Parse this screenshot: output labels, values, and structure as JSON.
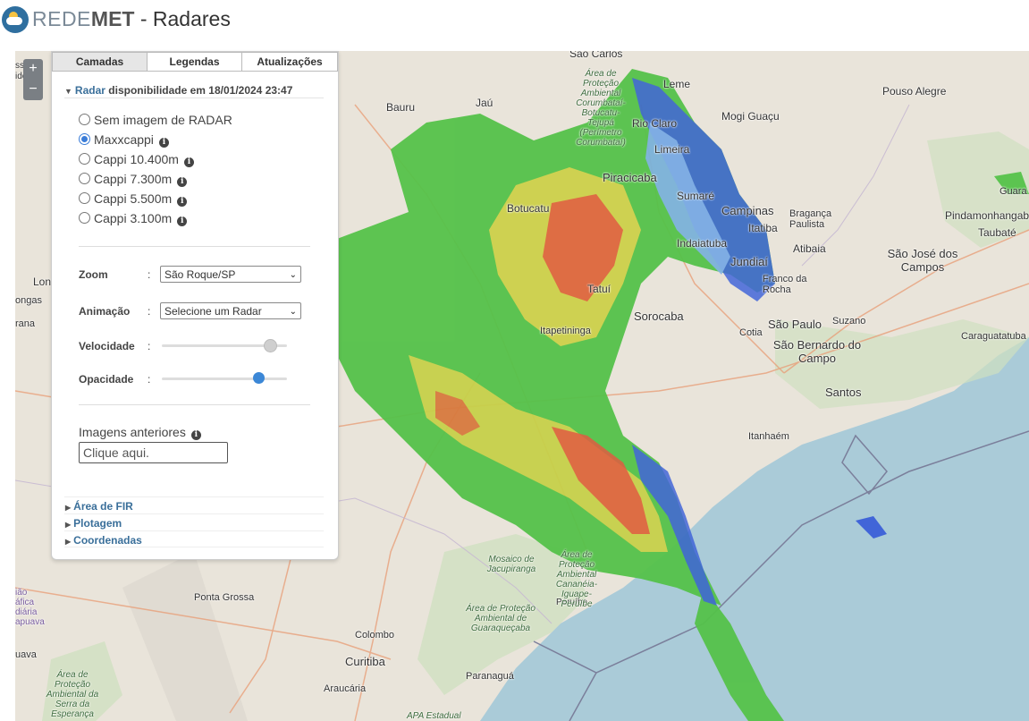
{
  "header": {
    "brand_light": "REDE",
    "brand_bold": "MET",
    "page_title": " - Radares"
  },
  "zoom_controls": {
    "zoom_in": "+",
    "zoom_out": "−"
  },
  "panel": {
    "tabs": [
      "Camadas",
      "Legendas",
      "Atualizações"
    ],
    "active_tab": "Camadas",
    "radar_section": {
      "title": "Radar",
      "subtitle": "disponibilidade em 18/01/2024 23:47",
      "options": [
        {
          "label": "Sem imagem de RADAR",
          "selected": false,
          "info": false
        },
        {
          "label": "Maxxcappi",
          "selected": true,
          "info": true
        },
        {
          "label": "Cappi 10.400m",
          "selected": false,
          "info": true
        },
        {
          "label": "Cappi 7.300m",
          "selected": false,
          "info": true
        },
        {
          "label": "Cappi 5.500m",
          "selected": false,
          "info": true
        },
        {
          "label": "Cappi 3.100m",
          "selected": false,
          "info": true
        }
      ],
      "zoom_label": "Zoom",
      "zoom_value": "São Roque/SP",
      "animation_label": "Animação",
      "animation_value": "Selecione um Radar",
      "speed_label": "Velocidade",
      "speed_level": 0.9,
      "opacity_label": "Opacidade",
      "opacity_level": 0.8,
      "separator": ":",
      "previous_images_label": "Imagens anteriores",
      "previous_images_placeholder": "Clique aqui."
    },
    "collapsed_sections": [
      "Área de FIR",
      "Plotagem",
      "Coordenadas"
    ]
  },
  "map": {
    "colors": {
      "land": "#e9e4da",
      "sea": "#aacbd8",
      "radar_green": "#55c24a",
      "radar_yellow": "#e3d34a",
      "radar_red": "#e0553a",
      "radar_blue": "#3b5fd8"
    },
    "labels": {
      "sao_carlos": "São Carlos",
      "bauru": "Bauru",
      "jau": "Jaú",
      "leme": "Leme",
      "mogi_guacu": "Mogi Guaçu",
      "pouso_alegre": "Pouso Alegre",
      "rio_claro": "Rio Claro",
      "limeira": "Limeira",
      "piracicaba": "Piracicaba",
      "sumare": "Sumaré",
      "campinas": "Campinas",
      "braganca": "Bragança Paulista",
      "pindamonhangaba": "Pindamonhangaba",
      "taubate": "Taubaté",
      "botucatu": "Botucatu",
      "itatiba": "Itatiba",
      "atibaia": "Atibaia",
      "sjc": "São José dos Campos",
      "indaiatuba": "Indaiatuba",
      "jundiai": "Jundiaí",
      "franco": "Franco da Rocha",
      "tatui": "Tatuí",
      "sorocaba": "Sorocaba",
      "sao_paulo": "São Paulo",
      "suzano": "Suzano",
      "caraguatatuba": "Caraguatatuba",
      "itapetininga": "Itapetininga",
      "cotia": "Cotia",
      "sbc": "São Bernardo do Campo",
      "santos": "Santos",
      "itanhaem": "Itanhaém",
      "peruibe": "Peruíbe",
      "ponta_grossa": "Ponta Grossa",
      "colombo": "Colombo",
      "curitiba": "Curitiba",
      "paranagua": "Paranaguá",
      "araucaria": "Araucária",
      "guara": "Guara",
      "lon": "Lon",
      "ongas": "ongas",
      "rana": "rana",
      "uava": "uava",
      "apa_corumbatai": "Área de Proteção Ambiental Corumbataí-Botucatu-Tejupá (Perímetro Corumbataí)",
      "apa_guaraquecaba": "Área de Proteção Ambiental de Guaraqueçaba",
      "mosaico_jacupiranga": "Mosaico de Jacupiranga",
      "apa_cananeia": "Área de Proteção Ambiental Cananéia-Iguape-Peruíbe",
      "apa_serra_esperanca": "Área de Proteção Ambiental da Serra da Esperança",
      "apa_estadual": "APA Estadual",
      "left_edge_1": "ssid",
      "left_edge_2": "idente",
      "left_edge_3": "ião",
      "left_edge_4": "áfica",
      "left_edge_5": "diária",
      "left_edge_6": "apuava"
    }
  }
}
